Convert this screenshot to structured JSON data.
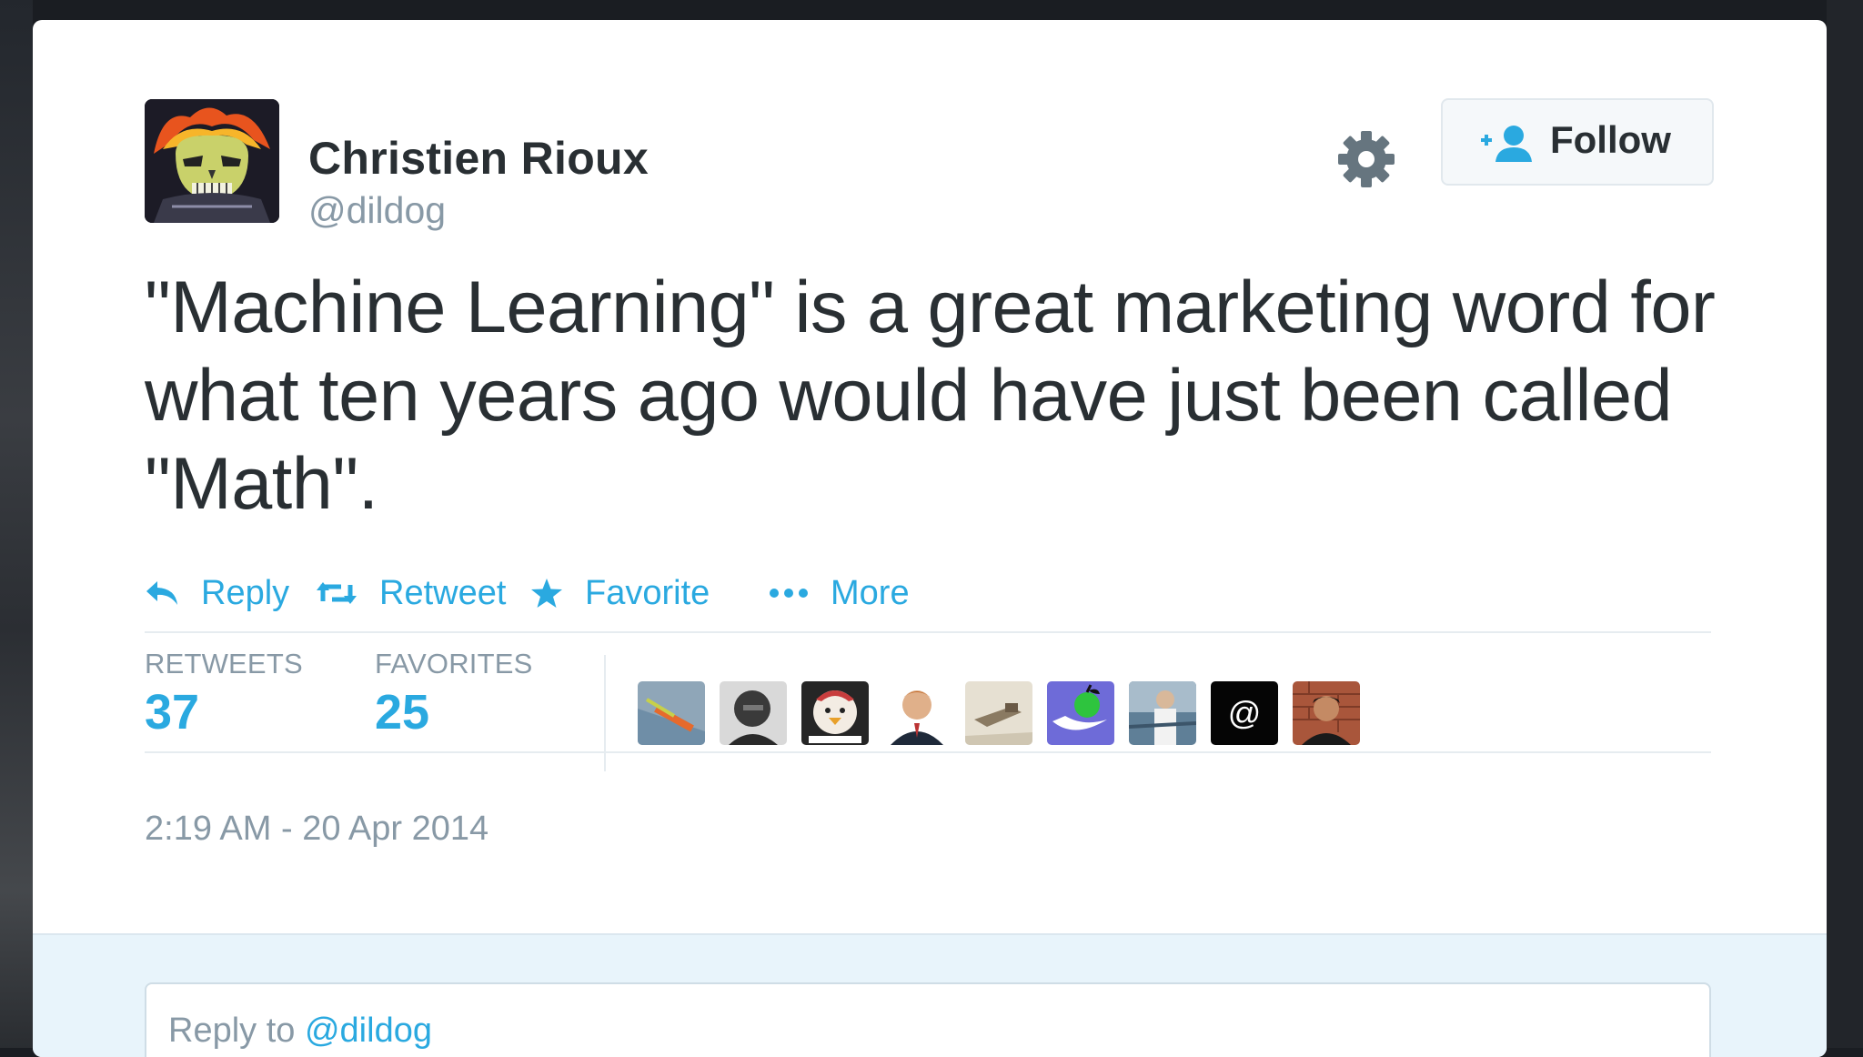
{
  "tweet": {
    "author_name": "Christien Rioux",
    "author_handle": "@dildog",
    "follow_label": "Follow",
    "text": "\"Machine Learning\" is a great marketing word for what ten years ago would have just been called \"Math\".",
    "actions": {
      "reply": "Reply",
      "retweet": "Retweet",
      "favorite": "Favorite",
      "more": "More"
    },
    "stats": {
      "retweets_label": "RETWEETS",
      "retweets_count": "37",
      "favorites_label": "FAVORITES",
      "favorites_count": "25"
    },
    "timestamp": "2:19 AM - 20 Apr 2014",
    "reply_prefix": "Reply to",
    "reply_handle": "@dildog"
  },
  "colors": {
    "link_blue": "#2aa9e0",
    "text_dark": "#292f33",
    "text_gray": "#8899a6",
    "reply_bg": "#e8f4fb"
  },
  "icons": [
    "gear-icon",
    "add-user-icon",
    "reply-icon",
    "retweet-icon",
    "star-icon",
    "more-dots-icon",
    "author-avatar"
  ]
}
